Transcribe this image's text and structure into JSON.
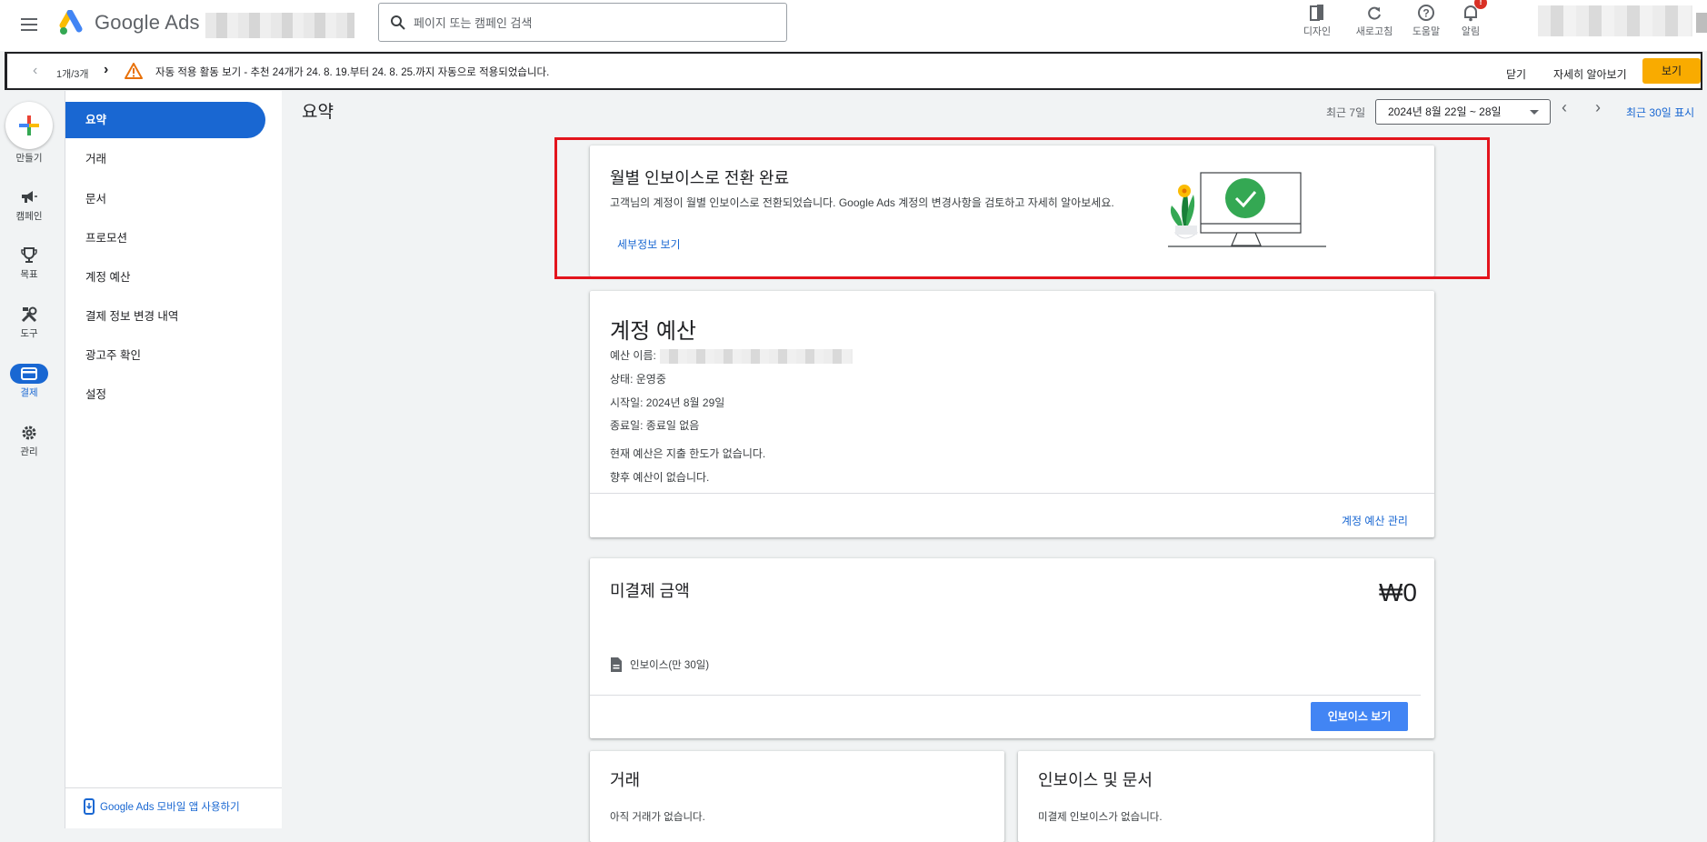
{
  "header": {
    "brand": "Google Ads",
    "search_placeholder": "페이지 또는 캠페인 검색",
    "actions": [
      {
        "label": "디자인",
        "icon": "design-icon"
      },
      {
        "label": "새로고침",
        "icon": "refresh-icon"
      },
      {
        "label": "도움말",
        "icon": "help-icon"
      },
      {
        "label": "알림",
        "icon": "bell-icon",
        "badge": "!"
      }
    ]
  },
  "notice": {
    "pager": "1개/3개",
    "message": "자동 적용 활동 보기 - 추천 24개가 24. 8. 19.부터 24. 8. 25.까지 자동으로 적용되었습니다.",
    "close_label": "닫기",
    "learn_label": "자세히 알아보기",
    "view_label": "보기"
  },
  "rail": {
    "create_label": "만들기",
    "items": [
      {
        "label": "캠페인",
        "icon": "megaphone-icon"
      },
      {
        "label": "목표",
        "icon": "trophy-icon"
      },
      {
        "label": "도구",
        "icon": "tools-icon"
      },
      {
        "label": "결제",
        "icon": "credit-card-icon",
        "active": true
      },
      {
        "label": "관리",
        "icon": "gear-icon"
      }
    ]
  },
  "sidebar": {
    "items": [
      {
        "label": "요약",
        "active": true
      },
      {
        "label": "거래"
      },
      {
        "label": "문서"
      },
      {
        "label": "프로모션"
      },
      {
        "label": "계정 예산"
      },
      {
        "label": "결제 정보 변경 내역"
      },
      {
        "label": "광고주 확인"
      },
      {
        "label": "설정"
      }
    ],
    "app_link": "Google Ads 모바일 앱 사용하기"
  },
  "page": {
    "title": "요약",
    "date_label": "최근 7일",
    "date_range": "2024년 8월 22일 ~ 28일",
    "last30_label": "최근 30일 표시"
  },
  "promo": {
    "title": "월별 인보이스로 전환 완료",
    "description": "고객님의 계정이 월별 인보이스로 전환되었습니다. Google Ads 계정의 변경사항을 검토하고 자세히 알아보세요.",
    "link": "세부정보 보기"
  },
  "budget": {
    "title": "계정 예산",
    "name_label": "예산 이름:",
    "status": "상태: 운영중",
    "start": "시작일: 2024년 8월 29일",
    "end": "종료일: 종료일 없음",
    "note1": "현재 예산은 지출 한도가 없습니다.",
    "note2": "향후 예산이 없습니다.",
    "manage_link": "계정 예산 관리"
  },
  "unpaid": {
    "title": "미결제 금액",
    "amount": "₩0",
    "invoice_label": "인보이스(만 30일)",
    "button": "인보이스 보기"
  },
  "transactions": {
    "title": "거래",
    "empty": "아직 거래가 없습니다."
  },
  "invoices": {
    "title": "인보이스 및 문서",
    "empty": "미결제 인보이스가 없습니다."
  }
}
